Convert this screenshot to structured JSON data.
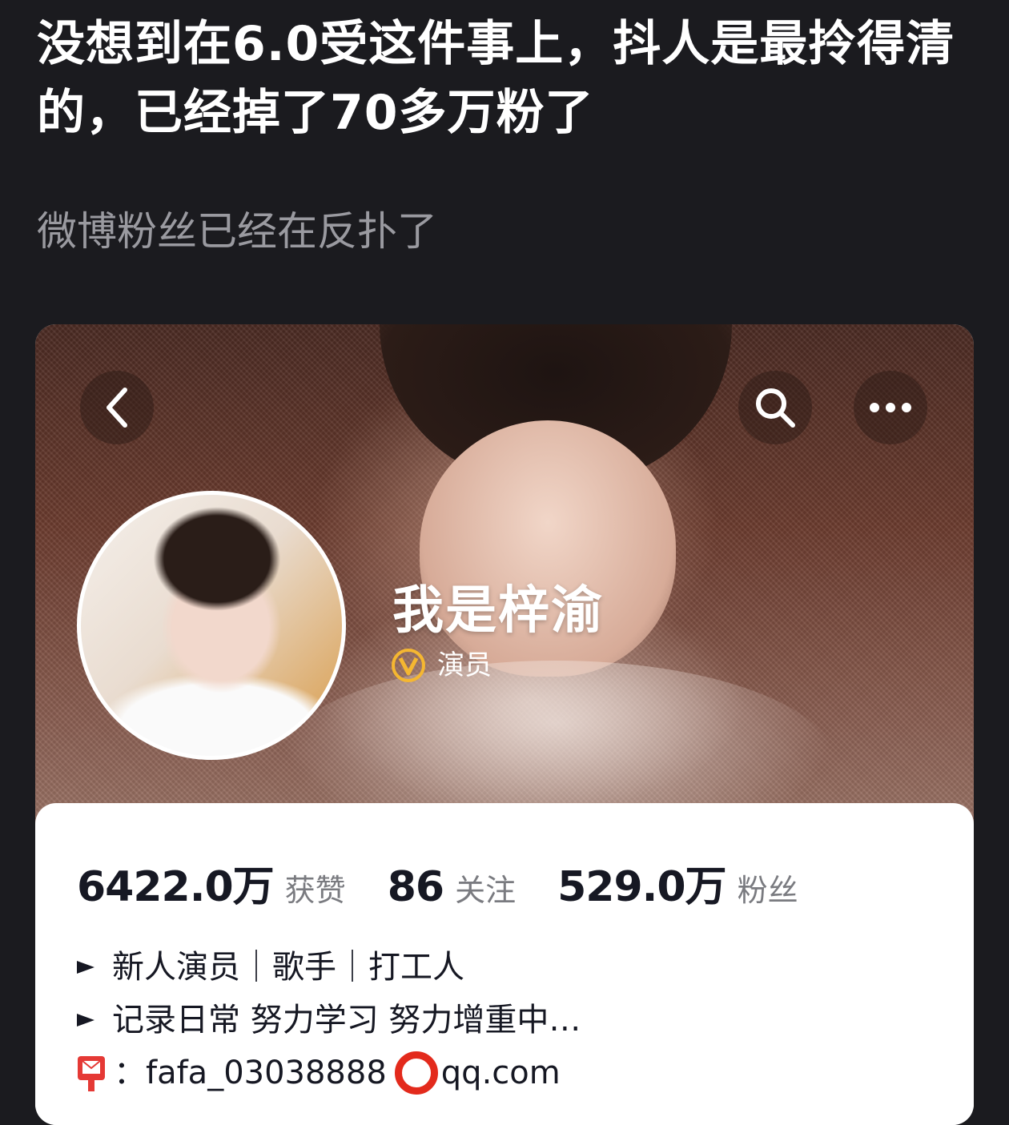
{
  "post": {
    "title": "没想到在6.0受这件事上，抖人是最拎得清的，已经掉了70多万粉了",
    "subtitle": "微博粉丝已经在反扑了"
  },
  "profile": {
    "name": "我是梓渝",
    "verified_label": "演员",
    "stats": [
      {
        "value": "6422.0万",
        "label": "获赞"
      },
      {
        "value": "86",
        "label": "关注"
      },
      {
        "value": "529.0万",
        "label": "粉丝"
      }
    ],
    "bio": {
      "line1": "新人演员｜歌手｜打工人",
      "line2": "记录日常 努力学习 努力增重中…",
      "contact_prefix": "：",
      "contact_user": "fafa_03038888",
      "contact_domain": "qq.com"
    }
  },
  "icons": {
    "back": "chevron-left-icon",
    "search": "search-icon",
    "more": "more-dots-icon",
    "verified": "verified-v-badge-icon",
    "bullet": "arrow-bullet-icon",
    "mail": "mailbox-icon",
    "at": "red-circle-icon"
  },
  "colors": {
    "background": "#1b1b1f",
    "title_text": "#ffffff",
    "subtitle_text": "#9a9aa0",
    "verified_badge": "#f5b731",
    "stat_value": "#161823",
    "stat_label": "#7a7b80",
    "at_ring": "#e32a1c"
  }
}
